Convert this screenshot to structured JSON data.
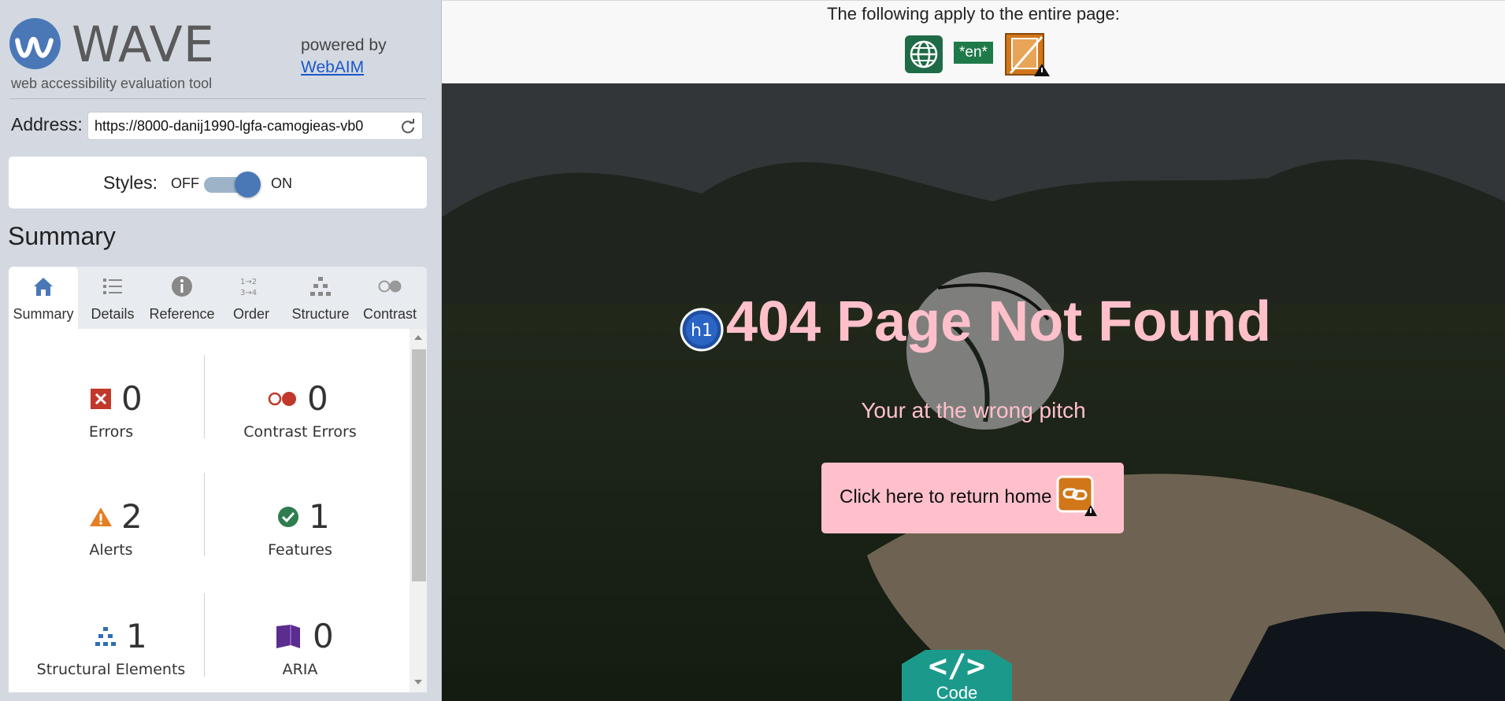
{
  "wave": {
    "logo_text": "WAVE",
    "logo_subtitle": "web accessibility evaluation tool",
    "powered_by": "powered by",
    "powered_link": "WebAIM",
    "address_label": "Address:",
    "address_value": "https://8000-danij1990-lgfa-camogieas-vb0",
    "styles_label": "Styles:",
    "styles_off": "OFF",
    "styles_on": "ON",
    "summary_heading": "Summary",
    "tabs": [
      {
        "label": "Summary",
        "icon": "home-icon",
        "active": true
      },
      {
        "label": "Details",
        "icon": "list-icon"
      },
      {
        "label": "Reference",
        "icon": "info-icon"
      },
      {
        "label": "Order",
        "icon": "order-icon"
      },
      {
        "label": "Structure",
        "icon": "structure-icon"
      },
      {
        "label": "Contrast",
        "icon": "contrast-icon"
      }
    ],
    "stats": [
      {
        "count": "0",
        "caption": "Errors",
        "icon": "error-icon"
      },
      {
        "count": "0",
        "caption": "Contrast Errors",
        "icon": "contrast-error-icon"
      },
      {
        "count": "2",
        "caption": "Alerts",
        "icon": "alert-icon"
      },
      {
        "count": "1",
        "caption": "Features",
        "icon": "feature-icon"
      },
      {
        "count": "1",
        "caption": "Structural Elements",
        "icon": "structure-icon"
      },
      {
        "count": "0",
        "caption": "ARIA",
        "icon": "aria-icon"
      }
    ]
  },
  "page": {
    "applies_text": "The following apply to the entire page:",
    "lang_badge": "*en*",
    "title": "404 Page Not Found",
    "h1_badge": "h1",
    "subtitle": "Your at the wrong pitch",
    "home_button": "Click here to return home",
    "code_tab": "Code",
    "code_glyph": "</>"
  },
  "colors": {
    "accent_blue": "#4a78b7",
    "pink_text": "#ffc0cb",
    "error_red": "#c0392b",
    "alert_orange": "#e67e22",
    "feature_green": "#2e7d4f",
    "aria_purple": "#5b2d8e",
    "code_teal": "#1b9a8c"
  }
}
